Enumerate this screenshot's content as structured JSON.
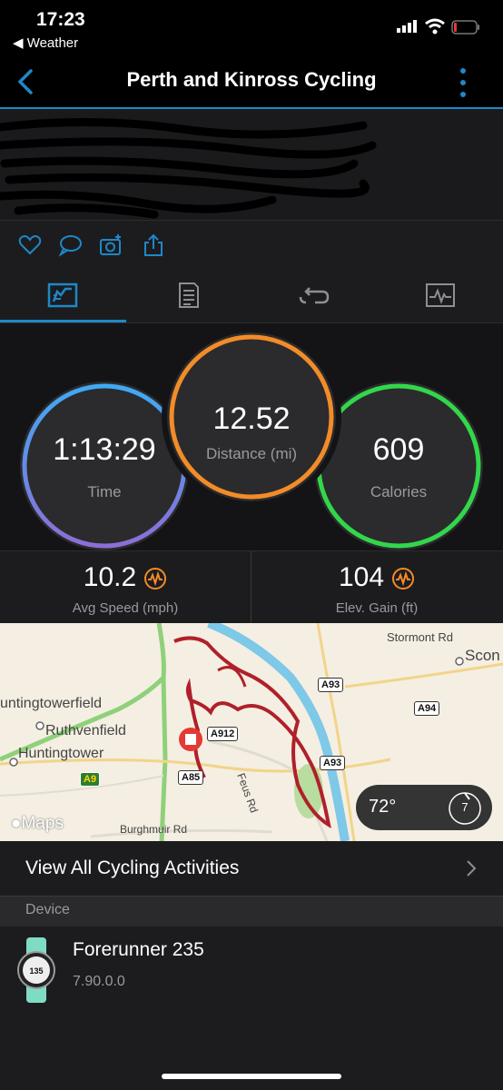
{
  "status_bar": {
    "time": "17:23",
    "back_app": "◀ Weather"
  },
  "nav": {
    "title": "Perth and Kinross Cycling"
  },
  "tabs": [
    {
      "name": "stats",
      "active": true
    },
    {
      "name": "details",
      "active": false
    },
    {
      "name": "laps",
      "active": false
    },
    {
      "name": "charts",
      "active": false
    }
  ],
  "rings": {
    "time": {
      "value": "1:13:29",
      "label": "Time",
      "color": "#4a9fe0"
    },
    "distance": {
      "value": "12.52",
      "label": "Distance (mi)",
      "color": "#f28c28"
    },
    "calories": {
      "value": "609",
      "label": "Calories",
      "color": "#32d74b"
    }
  },
  "metrics": {
    "avg_speed": {
      "value": "10.2",
      "label": "Avg Speed (mph)"
    },
    "elev_gain": {
      "value": "104",
      "label": "Elev. Gain (ft)"
    }
  },
  "map": {
    "labels": {
      "stormont": "Stormont Rd",
      "scone": "Scon",
      "huntingtowerfield": "untingtowerfield",
      "ruthvenfield": "Ruthvenfield",
      "huntingtower": "Huntingtower",
      "feus": "Feus Rd",
      "burghmuir": "Burghmuir Rd",
      "attribution": "Maps"
    },
    "roads": {
      "a93_top": "A93",
      "a94": "A94",
      "a912": "A912",
      "a93_bottom": "A93",
      "a85": "A85",
      "a9": "A9"
    },
    "weather": {
      "temp": "72°",
      "wind": "7"
    }
  },
  "links": {
    "view_all": "View All Cycling Activities"
  },
  "section": {
    "device_header": "Device"
  },
  "device": {
    "name": "Forerunner 235",
    "version": "7.90.0.0"
  }
}
